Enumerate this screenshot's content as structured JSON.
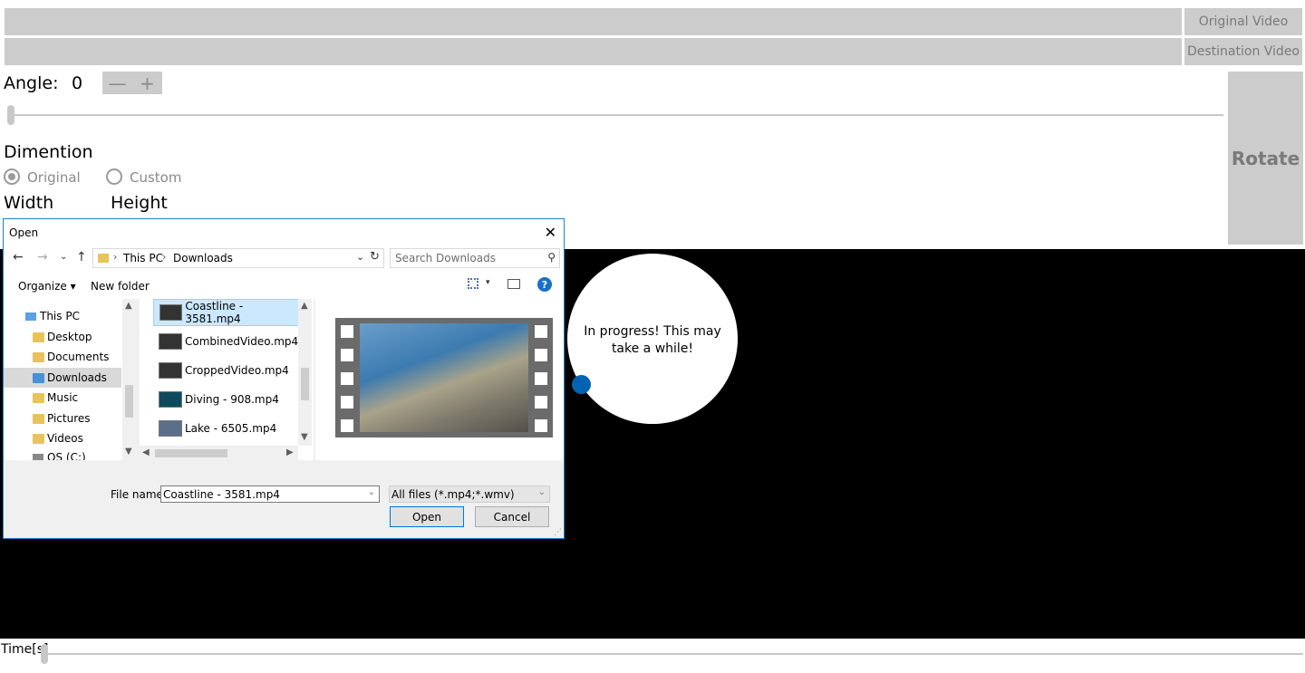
{
  "top": {
    "original_video_label": "Original Video",
    "destination_video_label": "Destination Video"
  },
  "angle": {
    "label": "Angle:",
    "value": "0",
    "minus": "—",
    "plus": "+",
    "slider_fraction": 0.0
  },
  "dimension": {
    "heading": "Dimention",
    "option_original": "Original",
    "option_custom": "Custom",
    "selected": "Original",
    "width_label": "Width",
    "height_label": "Height"
  },
  "rotate_label": "Rotate",
  "progress": {
    "text": "In progress! This may take a while!"
  },
  "time": {
    "label": "Time[s]",
    "slider_fraction": 0.0
  },
  "dialog": {
    "title": "Open",
    "close": "✕",
    "breadcrumb": [
      "This PC",
      "Downloads"
    ],
    "search_placeholder": "Search Downloads",
    "organize_label": "Organize",
    "new_folder_label": "New folder",
    "tree": [
      {
        "label": "This PC",
        "icon": "pc-icon"
      },
      {
        "label": "Desktop",
        "icon": "folder-icon"
      },
      {
        "label": "Documents",
        "icon": "folder-icon"
      },
      {
        "label": "Downloads",
        "icon": "downloads-folder-icon",
        "selected": true
      },
      {
        "label": "Music",
        "icon": "folder-icon"
      },
      {
        "label": "Pictures",
        "icon": "folder-icon"
      },
      {
        "label": "Videos",
        "icon": "folder-icon"
      },
      {
        "label": "OS (C:)",
        "icon": "drive-icon"
      }
    ],
    "files": [
      {
        "name": "Coastline - 3581.mp4",
        "selected": true
      },
      {
        "name": "CombinedVideo.mp4"
      },
      {
        "name": "CroppedVideo.mp4"
      },
      {
        "name": "Diving - 908.mp4"
      },
      {
        "name": "Lake - 6505.mp4"
      }
    ],
    "file_name_label": "File name:",
    "file_name_value": "Coastline - 3581.mp4",
    "filter_value": "All files (*.mp4;*.wmv)",
    "open_label": "Open",
    "cancel_label": "Cancel"
  },
  "colors": {
    "accent": "#0063b1",
    "panel_gray": "#cccccc",
    "dialog_border": "#1883d7",
    "selection": "#cce8ff"
  }
}
